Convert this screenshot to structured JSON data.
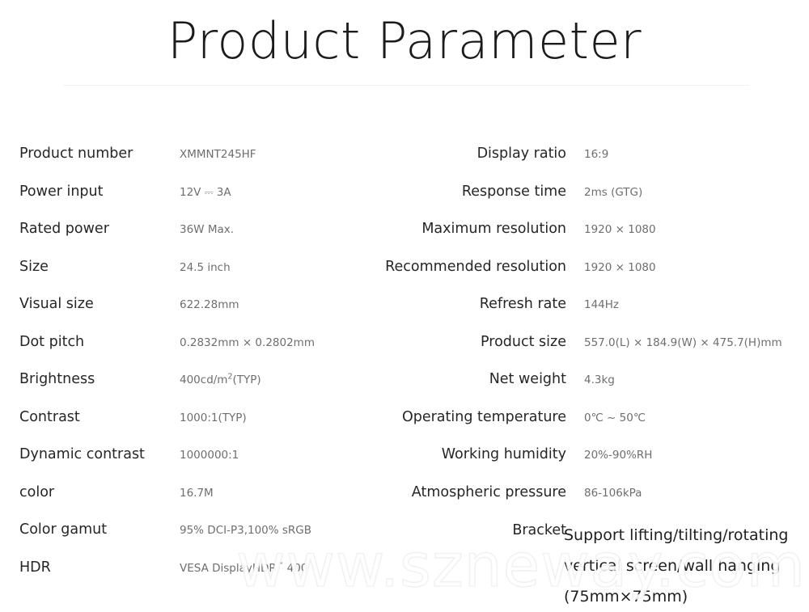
{
  "title": "Product Parameter",
  "watermark": "www.szneway.com",
  "specs": {
    "left": [
      {
        "label": "Product number",
        "value": "XMMNT245HF"
      },
      {
        "label": "Power input",
        "value": "12V ⎓ 3A"
      },
      {
        "label": "Rated power",
        "value": "36W Max."
      },
      {
        "label": "Size",
        "value": "24.5  inch"
      },
      {
        "label": "Visual size",
        "value": "622.28mm"
      },
      {
        "label": "Dot pitch",
        "value": "0.2832mm × 0.2802mm"
      },
      {
        "label": "Brightness",
        "value": "400cd/m²(TYP)"
      },
      {
        "label": "Contrast",
        "value": "1000:1(TYP)"
      },
      {
        "label": "Dynamic contrast",
        "value": "1000000:1"
      },
      {
        "label": "color",
        "value": "16.7M"
      },
      {
        "label": "Color gamut",
        "value": "95% DCI-P3,100% sRGB"
      },
      {
        "label": "HDR",
        "value": "VESA  DisplayHDR™ 400"
      }
    ],
    "right": [
      {
        "label": "Display ratio",
        "value": "16:9"
      },
      {
        "label": "Response time",
        "value": "2ms (GTG)"
      },
      {
        "label": "Maximum resolution",
        "value": "1920 × 1080"
      },
      {
        "label": "Recommended resolution",
        "value": "1920 × 1080"
      },
      {
        "label": "Refresh rate",
        "value": "144Hz"
      },
      {
        "label": "Product size",
        "value": "557.0(L) × 184.9(W) × 475.7(H)mm"
      },
      {
        "label": "Net weight",
        "value": "4.3kg"
      },
      {
        "label": "Operating temperature",
        "value": "0℃ ~ 50℃"
      },
      {
        "label": "Working humidity",
        "value": "20%-90%RH"
      },
      {
        "label": "Atmospheric pressure",
        "value": "86-106kPa"
      },
      {
        "label": "Bracket",
        "value_lines": [
          "Support lifting/tilting/rotating",
          "vertical screen/wall hanging",
          "(75mm×75mm)"
        ]
      }
    ]
  }
}
